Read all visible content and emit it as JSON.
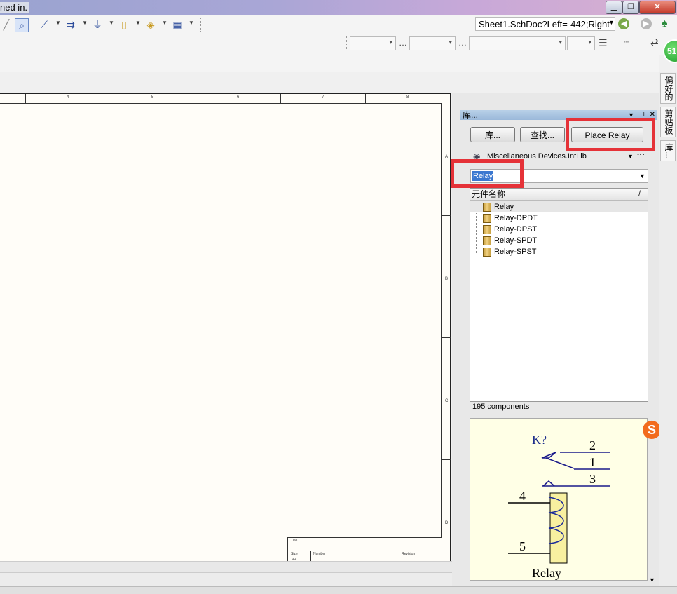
{
  "window": {
    "title_fragment": "ned in.",
    "controls": {
      "minimize": "▁",
      "maximize": "❐",
      "close": "✕"
    }
  },
  "toolbar": {
    "address": "Sheet1.SchDoc?Left=-442;Right",
    "icons": [
      "zoom-icon",
      "wire-icon",
      "bus-icon",
      "ground-icon",
      "component-icon",
      "port-icon",
      "grid-icon"
    ]
  },
  "badge": {
    "text": "51",
    "color": "#2aa836"
  },
  "schematic": {
    "column_numbers": [
      "4",
      "5",
      "6",
      "7",
      "8"
    ],
    "row_letters": [
      "A",
      "B",
      "C",
      "D"
    ],
    "title_block": {
      "title": "Title",
      "size": "Size",
      "size_value": "A4",
      "number": "Number",
      "revision": "Revision"
    }
  },
  "library_panel": {
    "header": "库...",
    "buttons": {
      "library": "库...",
      "search": "查找...",
      "place": "Place Relay"
    },
    "library_name": "Miscellaneous Devices.IntLib",
    "filter_value": "Relay",
    "column_header": "元件名称",
    "components": [
      "Relay",
      "Relay-DPDT",
      "Relay-DPST",
      "Relay-SPDT",
      "Relay-SPST"
    ],
    "count": "195 components",
    "preview": {
      "designator": "K?",
      "pins": [
        "2",
        "1",
        "3",
        "4",
        "5"
      ],
      "name": "Relay"
    }
  },
  "side_tabs": [
    "偏好的",
    "剪贴板",
    "库..."
  ],
  "highlight_color": "#e53238"
}
